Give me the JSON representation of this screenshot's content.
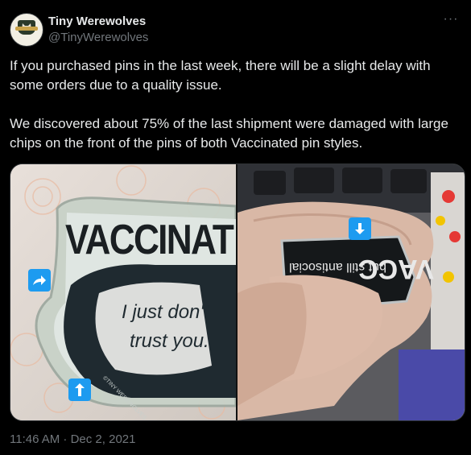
{
  "author": {
    "name": "Tiny Werewolves",
    "handle": "@TinyWerewolves",
    "avatar_icon": "werewolf-logo-icon"
  },
  "more_label": "···",
  "tweet_text": "If you purchased pins in the last week, there will be a slight delay with some orders due to a quality issue.\n\nWe discovered about 75% of the last shipment were damaged with large chips on the front of the pins of both Vaccinated pin styles.",
  "media": {
    "left_pin": {
      "headline": "VACCINAT",
      "mask_text_line1": "I just don't",
      "mask_text_line2": "trust you.",
      "brand_mark": "©TINY WEREWOLVES"
    },
    "right_pin": {
      "headline": "VACC",
      "subtext": "but still antisocial"
    },
    "accent_color": "#1d9bf0"
  },
  "timestamp": "11:46 AM · Dec 2, 2021"
}
